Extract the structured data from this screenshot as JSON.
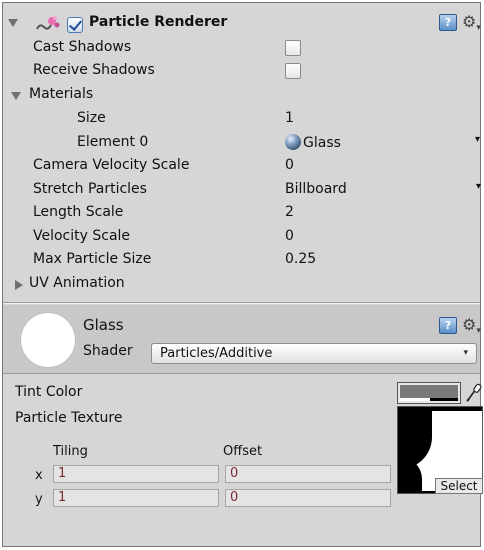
{
  "header": {
    "component_title": "Particle Renderer",
    "enabled": true
  },
  "properties": [
    {
      "label": "Cast Shadows",
      "type": "checkbox",
      "checked": false
    },
    {
      "label": "Receive Shadows",
      "type": "checkbox",
      "checked": false
    },
    {
      "label": "Materials",
      "type": "foldout",
      "expanded": true
    },
    {
      "label": "Size",
      "value": "1"
    },
    {
      "label": "Element 0",
      "value": "Glass",
      "icon": "sphere-icon"
    },
    {
      "label": "Camera Velocity Scale",
      "value": "0"
    },
    {
      "label": "Stretch Particles",
      "value": "Billboard"
    },
    {
      "label": "Length Scale",
      "value": "2"
    },
    {
      "label": "Velocity Scale",
      "value": "0"
    },
    {
      "label": "Max Particle Size",
      "value": "0.25"
    },
    {
      "label": "UV Animation",
      "type": "foldout",
      "expanded": false
    }
  ],
  "material": {
    "name": "Glass",
    "shader_label": "Shader",
    "shader_value": "Particles/Additive",
    "tint_label": "Tint Color",
    "texture_label": "Particle Texture",
    "select_label": "Select",
    "tiling_label": "Tiling",
    "offset_label": "Offset",
    "x_label": "x",
    "y_label": "y",
    "tiling_x": "1",
    "tiling_y": "1",
    "offset_x": "0",
    "offset_y": "0"
  },
  "colors": {
    "inspector_bg": "#d6d6d6",
    "material_header_bg": "#c8c8c8",
    "field_text": "#7a2a2a"
  }
}
